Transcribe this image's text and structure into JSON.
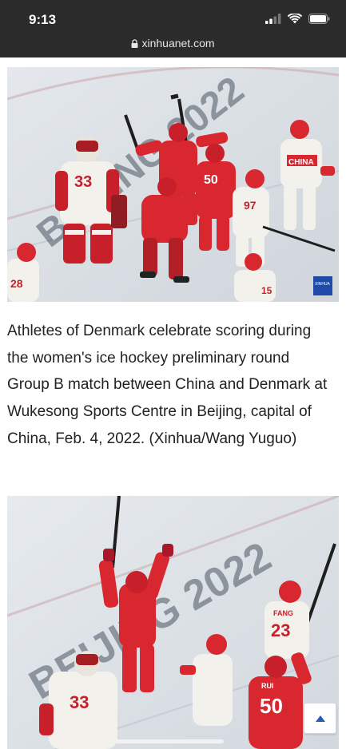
{
  "status_bar": {
    "time": "9:13",
    "icons": [
      "cellular-signal-icon",
      "wifi-icon",
      "battery-icon"
    ]
  },
  "browser": {
    "url": "xinhuanet.com",
    "lock_icon": "lock-icon"
  },
  "article": {
    "photo1": {
      "watermark_text": "BEIJING 2022",
      "logo_text": "XINHUA",
      "jerseys": [
        "33",
        "50",
        "97",
        "28",
        "15",
        "CHINA"
      ]
    },
    "caption": "Athletes of Denmark celebrate scoring during the women's ice hockey preliminary round Group B match between China and Denmark at Wukesong Sports Centre in Beijing, capital of China, Feb. 4, 2022. (Xinhua/Wang Yuguo)",
    "photo2": {
      "watermark_text": "BEIJING 2022",
      "jerseys": [
        "33",
        "50",
        "23",
        "FANG",
        "RUI"
      ]
    }
  },
  "back_to_top": {
    "icon": "arrow-up-icon"
  },
  "colors": {
    "status_bar_bg": "#2b2b2b",
    "denmark_red": "#d8272f",
    "china_white": "#f5f3ef",
    "up_arrow_blue": "#1f5fb5"
  }
}
